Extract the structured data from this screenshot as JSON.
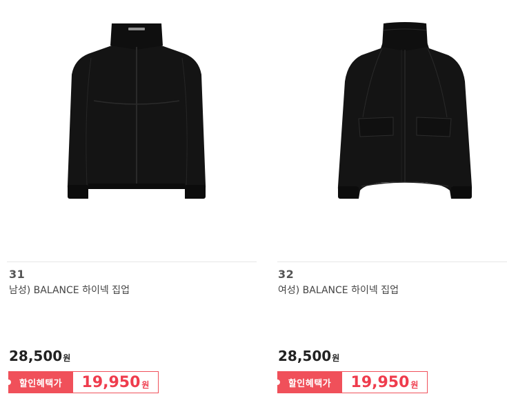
{
  "products": [
    {
      "number": "31",
      "name": "남성) BALANCE 하이넥 집업",
      "price": "28,500",
      "price_unit": "원",
      "sale_label": "할인혜택가",
      "sale_price": "19,950",
      "sale_unit": "원",
      "image": "black-zip-up-jacket-icon"
    },
    {
      "number": "32",
      "name": "여성) BALANCE 하이넥 집업",
      "price": "28,500",
      "price_unit": "원",
      "sale_label": "할인혜택가",
      "sale_price": "19,950",
      "sale_unit": "원",
      "image": "black-zip-up-jacket-with-pockets-icon"
    }
  ],
  "colors": {
    "sale_accent": "#f0505a",
    "sale_text": "#ef3c4d",
    "price_text": "#222222",
    "jacket": "#141414"
  }
}
